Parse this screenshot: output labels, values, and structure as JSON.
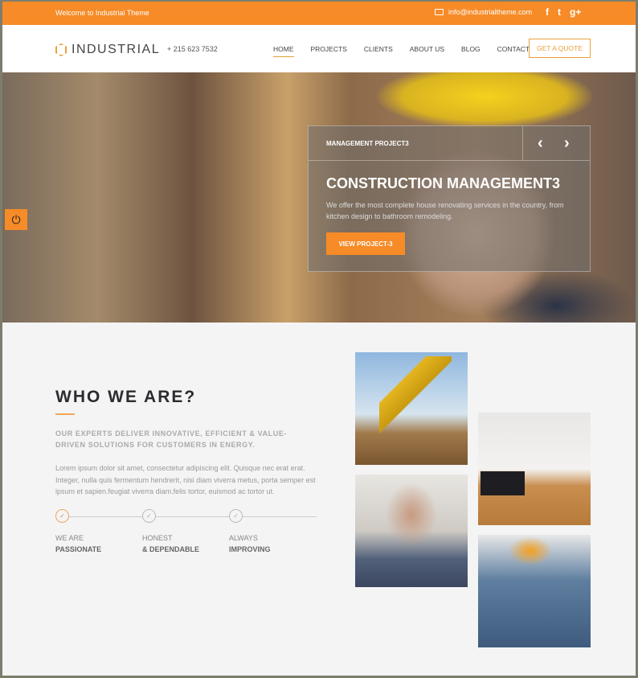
{
  "topbar": {
    "welcome": "Welcome to Industrial Theme",
    "email": "info@industrialtheme.com",
    "social": [
      "f",
      "t",
      "g+"
    ]
  },
  "header": {
    "logo": "INDUSTRIAL",
    "phone": "+ 215 623 7532",
    "nav": [
      "HOME",
      "PROJECTS",
      "CLIENTS",
      "ABOUT US",
      "BLOG",
      "CONTACT"
    ],
    "active": "HOME",
    "quote": "GET A QUOTE"
  },
  "slider": {
    "subtitle": "MANAGEMENT PROJECT3",
    "title": "CONSTRUCTION MANAGEMENT3",
    "text": "We offer the most complete house renovating services in the country, from kitchen design to bathroom remodeling.",
    "button": "VIEW PROJECT-3",
    "prev": "‹",
    "next": "›"
  },
  "about": {
    "title": "WHO WE ARE?",
    "lead": "OUR EXPERTS DELIVER INNOVATIVE, EFFICIENT & VALUE-DRIVEN SOLUTIONS FOR CUSTOMERS IN ENERGY.",
    "body": "Lorem ipsum dolor sit amet, consectetur adipiscing elit. Quisque nec erat erat. Integer, nulla quis fermentum hendrerit, nisi diam viverra metus, porta semper est ipsum et sapien.feugiat viverra diam.felis tortor, euismod ac tortor ut.",
    "steps": [
      {
        "l1": "WE ARE",
        "l2": "PASSIONATE"
      },
      {
        "l1": "HONEST",
        "l2": "& DEPENDABLE"
      },
      {
        "l1": "ALWAYS",
        "l2": "IMPROVING"
      }
    ]
  },
  "colors": {
    "accent": "#f68b27"
  }
}
